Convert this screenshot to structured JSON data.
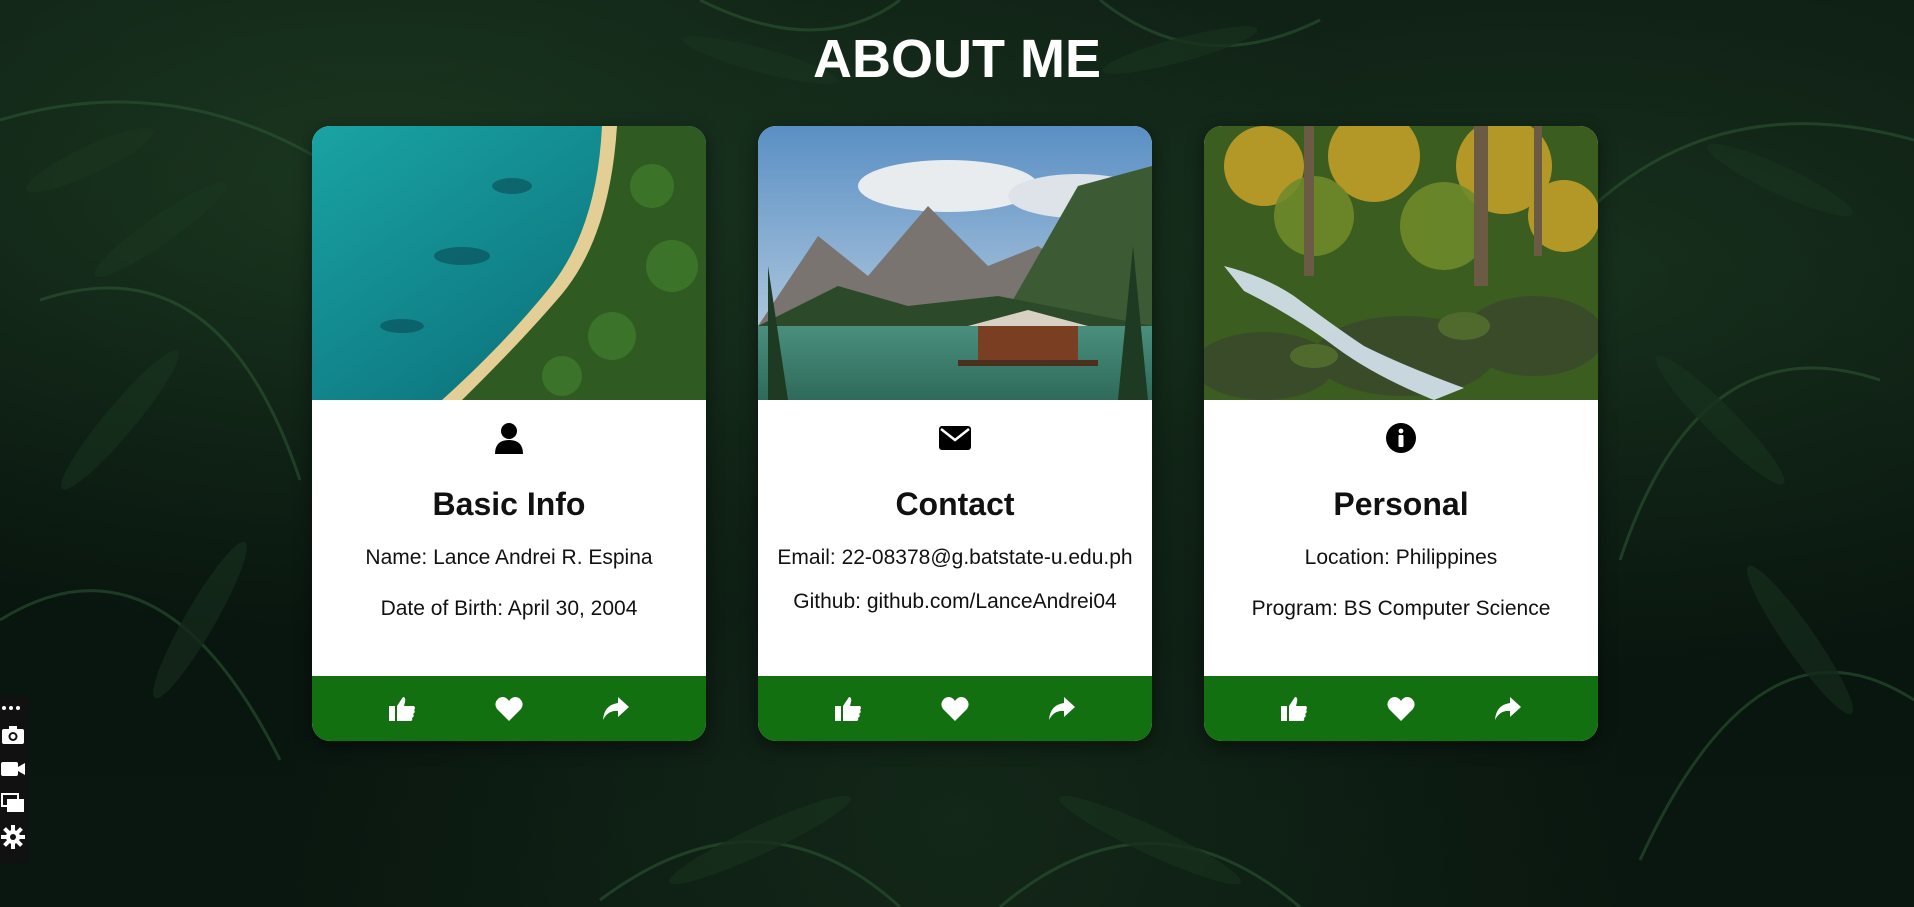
{
  "page": {
    "title": "ABOUT ME"
  },
  "cards": [
    {
      "icon": "user-icon",
      "image": "aerial-beach-coastline",
      "title": "Basic Info",
      "lines": [
        "Name: Lance Andrei R. Espina",
        "Date of Birth: April 30, 2004"
      ]
    },
    {
      "icon": "envelope-icon",
      "image": "mountain-lake-cabin",
      "title": "Contact",
      "lines": [
        "Email: 22-08378@g.batstate-u.edu.ph",
        "Github: github.com/LanceAndrei04"
      ]
    },
    {
      "icon": "info-circle-icon",
      "image": "forest-waterfall",
      "title": "Personal",
      "lines": [
        "Location: Philippines",
        "Program: BS Computer Science"
      ]
    }
  ],
  "footer_actions": [
    "thumbs-up-icon",
    "heart-icon",
    "share-icon"
  ],
  "side_toolbar": [
    "more-icon",
    "camera-icon",
    "video-icon",
    "windows-icon",
    "gear-icon"
  ],
  "colors": {
    "footer": "#127010",
    "card_bg": "#ffffff",
    "title_text": "#ffffff",
    "body_text": "#111111"
  }
}
